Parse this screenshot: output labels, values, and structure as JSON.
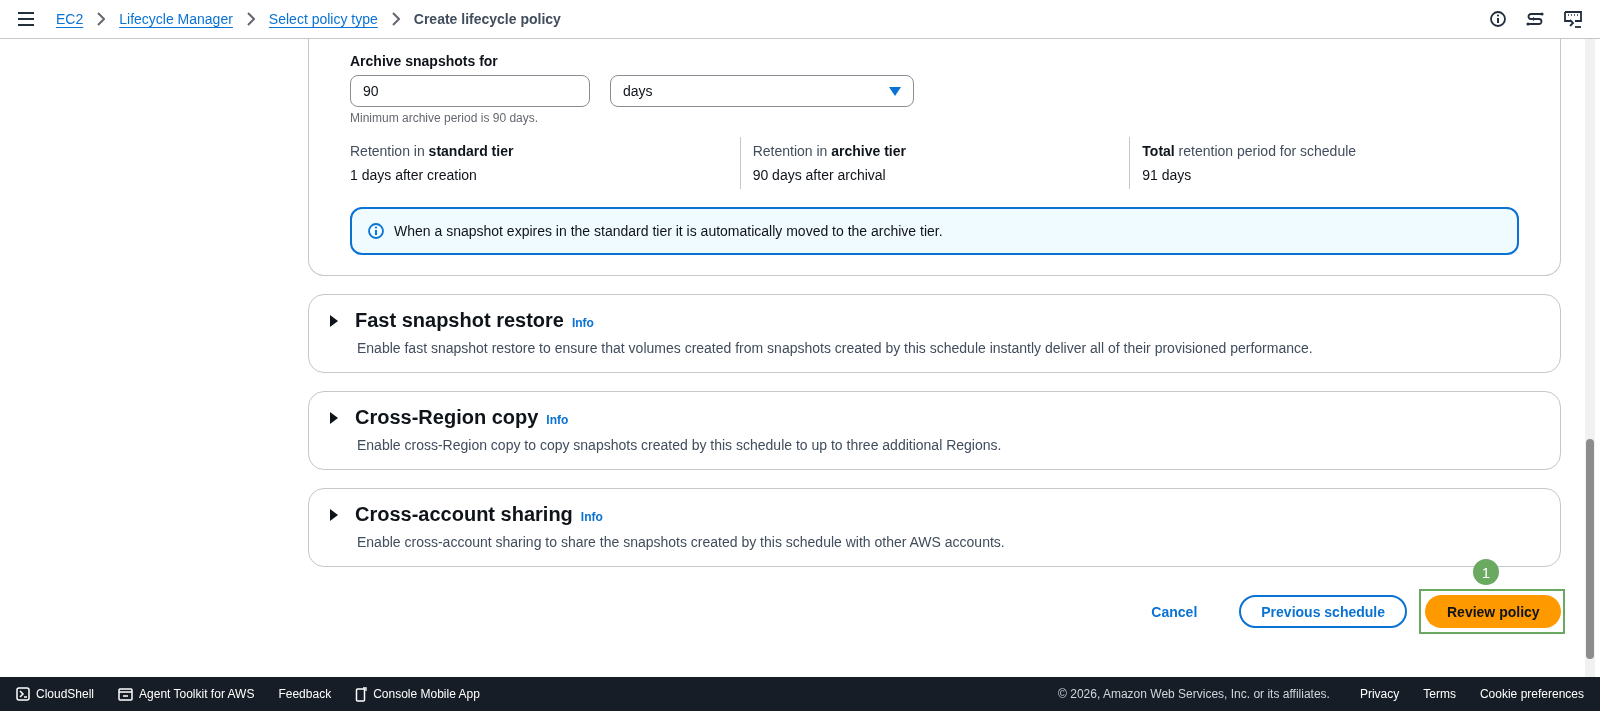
{
  "breadcrumbs": [
    {
      "label": "EC2",
      "link": true
    },
    {
      "label": "Lifecycle Manager",
      "link": true
    },
    {
      "label": "Select policy type",
      "link": true
    },
    {
      "label": "Create lifecycle policy",
      "link": false
    }
  ],
  "archive": {
    "label": "Archive snapshots for",
    "value": "90",
    "unit": "days",
    "hint": "Minimum archive period is 90 days.",
    "retention": [
      {
        "label": "Retention in **standard tier**",
        "value": "1 days after creation"
      },
      {
        "label": "Retention in **archive tier**",
        "value": "90 days after archival"
      },
      {
        "label": "**Total** retention period for schedule",
        "value": "91 days"
      }
    ],
    "alert": "When a snapshot expires in the standard tier it is automatically moved to the archive tier."
  },
  "sections": [
    {
      "title": "Fast snapshot restore",
      "info": "Info",
      "description": "Enable fast snapshot restore to ensure that volumes created from snapshots created by this schedule instantly deliver all of their provisioned performance.",
      "expanded": false
    },
    {
      "title": "Cross-Region copy",
      "info": "Info",
      "description": "Enable cross-Region copy to copy snapshots created by this schedule to up to three additional Regions.",
      "expanded": false
    },
    {
      "title": "Cross-account sharing",
      "info": "Info",
      "description": "Enable cross-account sharing to share the snapshots created by this schedule with other AWS accounts.",
      "expanded": false
    }
  ],
  "actions": [
    {
      "label": "Cancel",
      "kind": "link"
    },
    {
      "label": "Previous schedule",
      "kind": "secondary"
    },
    {
      "label": "Review policy",
      "kind": "primary"
    }
  ],
  "step_marker": {
    "number": "1"
  },
  "footer": {
    "left": [
      {
        "label": "CloudShell",
        "kind": "terminal"
      },
      {
        "label": "Agent Toolkit for AWS",
        "kind": "window"
      },
      {
        "label": "Feedback",
        "kind": "text"
      },
      {
        "label": "Console Mobile App",
        "kind": "phone"
      }
    ],
    "copyright": "© 2026, Amazon Web Services, Inc. or its affiliates.",
    "links": [
      "Privacy",
      "Terms",
      "Cookie preferences"
    ]
  }
}
